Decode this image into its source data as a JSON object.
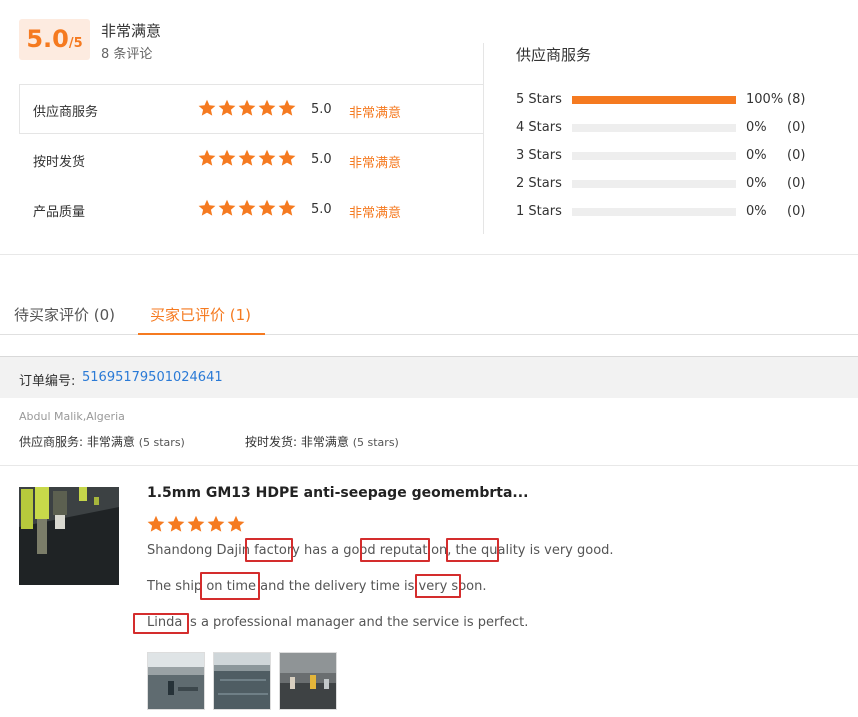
{
  "summary": {
    "score": "5.0",
    "score_max": "/5",
    "overall_label": "非常满意",
    "review_count": "8 条评论",
    "metrics": [
      {
        "name": "供应商服务",
        "score": "5.0",
        "label": "非常满意",
        "rating": 5
      },
      {
        "name": "按时发货",
        "score": "5.0",
        "label": "非常满意",
        "rating": 5
      },
      {
        "name": "产品质量",
        "score": "5.0",
        "label": "非常满意",
        "rating": 5
      }
    ]
  },
  "distribution": {
    "title": "供应商服务",
    "rows": [
      {
        "label": "5  Stars",
        "fraction": 1.0,
        "percent": "100%",
        "count": "(8)"
      },
      {
        "label": "4  Stars",
        "fraction": 0.0,
        "percent": "0%",
        "count": "(0)"
      },
      {
        "label": "3  Stars",
        "fraction": 0.0,
        "percent": "0%",
        "count": "(0)"
      },
      {
        "label": "2  Stars",
        "fraction": 0.0,
        "percent": "0%",
        "count": "(0)"
      },
      {
        "label": "1  Stars",
        "fraction": 0.0,
        "percent": "0%",
        "count": "(0)"
      }
    ]
  },
  "tabs": [
    {
      "label": "待买家评价 (0)",
      "active": false
    },
    {
      "label": "买家已评价 (1)",
      "active": true
    }
  ],
  "order": {
    "label": "订单编号:",
    "number": "51695179501024641"
  },
  "review": {
    "buyer": "Abdul Malik,Algeria",
    "service_label": "供应商服务:",
    "service_value": "非常满意",
    "service_stars": "(5 stars)",
    "delivery_label": "按时发货:",
    "delivery_value": "非常满意",
    "delivery_stars": "(5 stars)",
    "product_title": "1.5mm GM13 HDPE anti-seepage geomembrta...",
    "rating": 5,
    "lines": [
      "Shandong Dajin factory has a good reputation, the quality is very good.",
      "The ship on time and the delivery time is very soon.",
      "Linda is a professional manager and the service is perfect."
    ]
  },
  "colors": {
    "accent": "#f57a20",
    "link": "#2a7ad6",
    "highlight_box": "#d42d2d"
  },
  "icons": {
    "star": "star-icon"
  }
}
